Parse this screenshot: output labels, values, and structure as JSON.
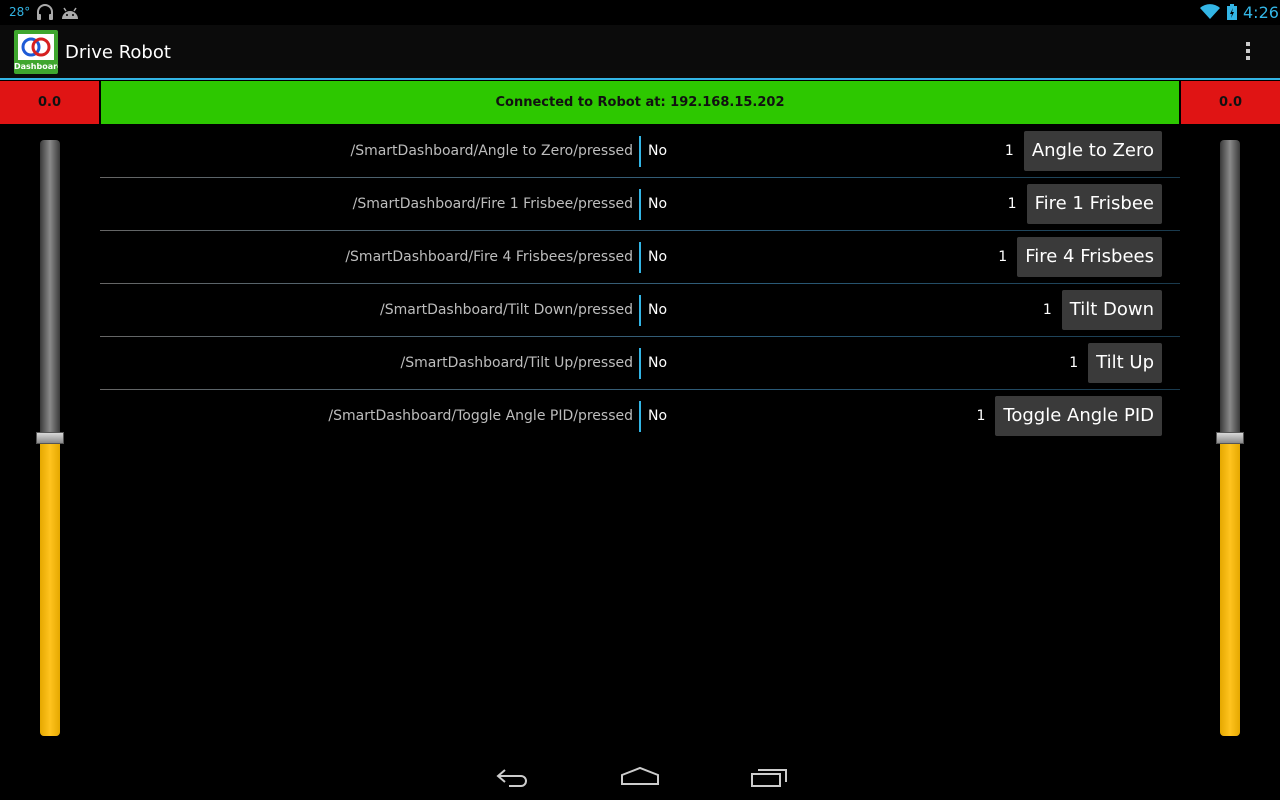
{
  "status_bar": {
    "temperature": "28°",
    "time": "4:26",
    "icons": [
      "headphones-icon",
      "android-icon",
      "wifi-icon",
      "battery-icon"
    ]
  },
  "action_bar": {
    "icon_text": "Dashboard",
    "title": "Drive Robot",
    "overflow_icon": "overflow-menu-icon"
  },
  "banner": {
    "left_value": "0.0",
    "status": "Connected to Robot at: 192.168.15.202",
    "right_value": "0.0",
    "colors": {
      "connected": "#2dc800",
      "value_box": "#e01414"
    }
  },
  "sliders": {
    "left_level": 0.5,
    "right_level": 0.5
  },
  "rows": [
    {
      "key": "/SmartDashboard/Angle to Zero/pressed",
      "value": "No",
      "count": "1",
      "button": "Angle to Zero"
    },
    {
      "key": "/SmartDashboard/Fire 1 Frisbee/pressed",
      "value": "No",
      "count": "1",
      "button": "Fire 1 Frisbee"
    },
    {
      "key": "/SmartDashboard/Fire 4 Frisbees/pressed",
      "value": "No",
      "count": "1",
      "button": "Fire 4 Frisbees"
    },
    {
      "key": "/SmartDashboard/Tilt Down/pressed",
      "value": "No",
      "count": "1",
      "button": "Tilt Down"
    },
    {
      "key": "/SmartDashboard/Tilt Up/pressed",
      "value": "No",
      "count": "1",
      "button": "Tilt Up"
    },
    {
      "key": "/SmartDashboard/Toggle Angle PID/pressed",
      "value": "No",
      "count": "1",
      "button": "Toggle Angle PID"
    }
  ],
  "nav_bar": {
    "icons": [
      "back-icon",
      "home-icon",
      "recents-icon"
    ]
  }
}
